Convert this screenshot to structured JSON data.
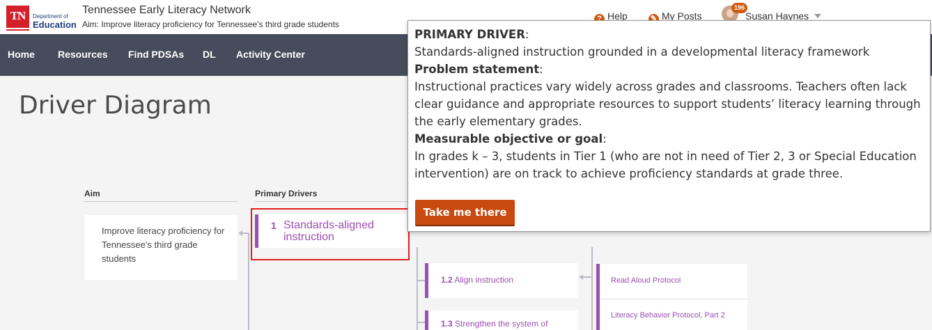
{
  "header": {
    "logo": {
      "tn": "TN",
      "dept": "Department of",
      "edu": "Education"
    },
    "site_title": "Tennessee Early Literacy Network",
    "aim_text": "Aim:  Improve literacy proficiency for Tennessee's third grade students",
    "help_label": "Help",
    "posts_label": "My Posts",
    "notification_count": "196",
    "user_name": "Susan Haynes"
  },
  "nav": {
    "items": [
      "Home",
      "Resources",
      "Find PDSAs",
      "DL",
      "Activity Center"
    ]
  },
  "page": {
    "title": "Driver Diagram"
  },
  "diagram": {
    "col_aim": "Aim",
    "col_primary": "Primary Drivers",
    "aim_card": "Improve literacy proficiency for Tennessee's third grade students",
    "primary_driver": {
      "num": "1",
      "text": "Standards-aligned instruction"
    },
    "secondary": [
      {
        "num": "1.2",
        "text": "Align instruction"
      },
      {
        "num": "1.3",
        "text": "Strengthen the system of"
      }
    ],
    "change_ideas": [
      "Read Aloud Protocol",
      "Literacy Behavior Protocol, Part 2"
    ]
  },
  "popover": {
    "driver_label": "PRIMARY DRIVER",
    "driver_text": "Standards-aligned instruction grounded in a developmental literacy framework",
    "problem_label": "Problem statement",
    "problem_text": "Instructional practices vary widely across grades and classrooms. Teachers often lack clear guidance and appropriate resources to support students’ literacy learning through the early elementary grades.",
    "goal_label": "Measurable objective or goal",
    "goal_text": "In grades k – 3, students in Tier 1 (who are not in need of Tier 2, 3 or Special Education intervention) are on track to achieve proficiency standards at grade three.",
    "cta_label": "Take me there"
  },
  "colors": {
    "nav_bg": "#464c5b",
    "accent_purple": "#9b4fb1",
    "cta_orange": "#c84a0e",
    "highlight_red": "#e21d1d"
  }
}
